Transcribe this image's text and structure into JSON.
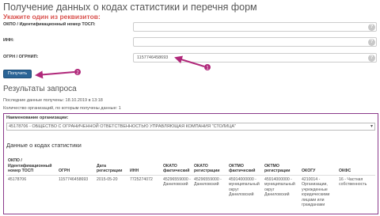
{
  "header": {
    "title": "Получение данных о кодах статистики и перечня форм",
    "subtitle": "Укажите один из реквизитов:"
  },
  "form": {
    "okpo_label": "ОКПО / Идентификационный номер ТОСП:",
    "okpo_value": "",
    "inn_label": "ИНН:",
    "inn_value": "",
    "ogrn_label": "ОГРН / ОГРНИП:",
    "ogrn_value": "1157746458693",
    "help_glyph": "?",
    "submit_label": "Получить"
  },
  "annotations": {
    "marker_1": "1",
    "marker_2": "2",
    "marker_color": "#b0287a"
  },
  "results": {
    "title": "Результаты запроса",
    "last_received": "Последние данные получены: 18.10.2019 в 13:18",
    "org_count": "Количество организаций, по которым получены данные: 1",
    "org_label": "Наименование организации:",
    "org_selected": "45178706 - ОБЩЕСТВО С ОГРАНИЧЕННОЙ ОТВЕТСТВЕННОСТЬЮ УПРАВЛЯЮЩАЯ КОМПАНИЯ \"СТОЛИЦА\"",
    "stats_title": "Данные о кодах статистики"
  },
  "table": {
    "headers": [
      "ОКПО / Идентификационный номер ТОСП",
      "ОГРН",
      "Дата регистрации",
      "ИНН",
      "ОКАТО фактический",
      "ОКАТО регистрации",
      "ОКТМО фактический",
      "ОКТМО регистрации",
      "ОКОГУ",
      "ОКФС"
    ],
    "row": [
      "45178706",
      "1157746458693",
      "2015-05-20",
      "7725274072",
      "45296559000 - Даниловский",
      "45296559000 - Даниловский",
      "45914000000 - муниципальный округ Даниловский",
      "45914000000 - муниципальный округ Даниловский",
      "4210014 - Организации, учрежденные юридическими лицами или гражданами",
      "16 - Частная собственность"
    ]
  }
}
